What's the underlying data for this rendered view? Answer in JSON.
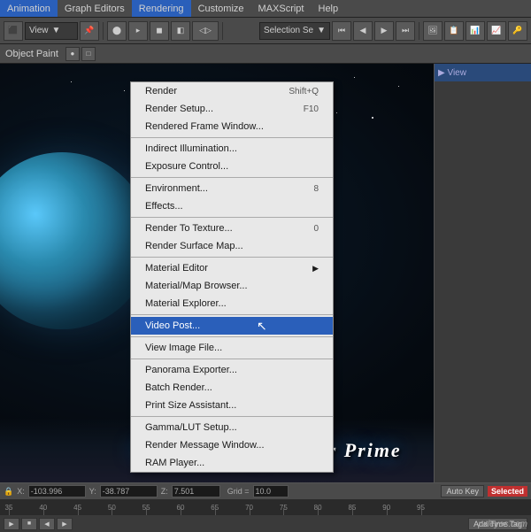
{
  "menubar": {
    "items": [
      {
        "id": "animation",
        "label": "Animation"
      },
      {
        "id": "graph-editors",
        "label": "Graph Editors"
      },
      {
        "id": "rendering",
        "label": "Rendering"
      },
      {
        "id": "customize",
        "label": "Customize"
      },
      {
        "id": "maxscript",
        "label": "MAXScript"
      },
      {
        "id": "help",
        "label": "Help"
      }
    ]
  },
  "toolbar": {
    "view_label": "View",
    "dropdown_arrow": "▼"
  },
  "object_paint_bar": {
    "label": "Object Paint",
    "icon_symbol": "🖌"
  },
  "rendering_menu": {
    "items": [
      {
        "id": "render",
        "label": "Render",
        "shortcut": "Shift+Q",
        "has_arrow": false,
        "highlighted": false
      },
      {
        "id": "render-setup",
        "label": "Render Setup...",
        "shortcut": "F10",
        "has_arrow": false,
        "highlighted": false
      },
      {
        "id": "rendered-frame-window",
        "label": "Rendered Frame Window...",
        "shortcut": "",
        "has_arrow": false,
        "highlighted": false
      },
      {
        "id": "sep1",
        "separator": true
      },
      {
        "id": "indirect-illumination",
        "label": "Indirect Illumination...",
        "shortcut": "",
        "has_arrow": false,
        "highlighted": false
      },
      {
        "id": "exposure-control",
        "label": "Exposure Control...",
        "shortcut": "",
        "has_arrow": false,
        "highlighted": false
      },
      {
        "id": "sep2",
        "separator": true
      },
      {
        "id": "environment",
        "label": "Environment...",
        "shortcut": "8",
        "has_arrow": false,
        "highlighted": false
      },
      {
        "id": "effects",
        "label": "Effects...",
        "shortcut": "",
        "has_arrow": false,
        "highlighted": false
      },
      {
        "id": "sep3",
        "separator": true
      },
      {
        "id": "render-to-texture",
        "label": "Render To Texture...",
        "shortcut": "0",
        "has_arrow": false,
        "highlighted": false
      },
      {
        "id": "render-surface-map",
        "label": "Render Surface Map...",
        "shortcut": "",
        "has_arrow": false,
        "highlighted": false
      },
      {
        "id": "sep4",
        "separator": true
      },
      {
        "id": "material-editor",
        "label": "Material Editor",
        "shortcut": "",
        "has_arrow": true,
        "highlighted": false
      },
      {
        "id": "material-map-browser",
        "label": "Material/Map Browser...",
        "shortcut": "",
        "has_arrow": false,
        "highlighted": false
      },
      {
        "id": "material-explorer",
        "label": "Material Explorer...",
        "shortcut": "",
        "has_arrow": false,
        "highlighted": false
      },
      {
        "id": "sep5",
        "separator": true
      },
      {
        "id": "video-post",
        "label": "Video Post...",
        "shortcut": "",
        "has_arrow": false,
        "highlighted": true
      },
      {
        "id": "sep6",
        "separator": true
      },
      {
        "id": "view-image-file",
        "label": "View Image File...",
        "shortcut": "",
        "has_arrow": false,
        "highlighted": false
      },
      {
        "id": "sep7",
        "separator": true
      },
      {
        "id": "panorama-exporter",
        "label": "Panorama Exporter...",
        "shortcut": "",
        "has_arrow": false,
        "highlighted": false
      },
      {
        "id": "batch-render",
        "label": "Batch Render...",
        "shortcut": "",
        "has_arrow": false,
        "highlighted": false
      },
      {
        "id": "print-size-assistant",
        "label": "Print Size Assistant...",
        "shortcut": "",
        "has_arrow": false,
        "highlighted": false
      },
      {
        "id": "sep8",
        "separator": true
      },
      {
        "id": "gamma-lut-setup",
        "label": "Gamma/LUT Setup...",
        "shortcut": "",
        "has_arrow": false,
        "highlighted": false
      },
      {
        "id": "render-message-window",
        "label": "Render Message Window...",
        "shortcut": "",
        "has_arrow": false,
        "highlighted": false
      },
      {
        "id": "ram-player",
        "label": "RAM Player...",
        "shortcut": "",
        "has_arrow": false,
        "highlighted": false
      }
    ]
  },
  "scene": {
    "title": "The Planet Of Zentar Prime"
  },
  "timeline": {
    "ruler_ticks": [
      35,
      40,
      45,
      50,
      55,
      60,
      65,
      70,
      75,
      80,
      85,
      90,
      95
    ],
    "coord_x_label": "X:",
    "coord_x_value": "-103.996",
    "coord_y_label": "Y:",
    "coord_y_value": "-38.787",
    "coord_z_label": "Z:",
    "coord_z_value": "7.501",
    "grid_label": "Grid =",
    "grid_value": "10.0",
    "auto_key_label": "Auto Key",
    "selected_label": "Selected",
    "add_time_tag_label": "Add Time Tag"
  },
  "watermark": {
    "text": "pxleyes.com"
  },
  "cursor": {
    "symbol": "↖"
  }
}
